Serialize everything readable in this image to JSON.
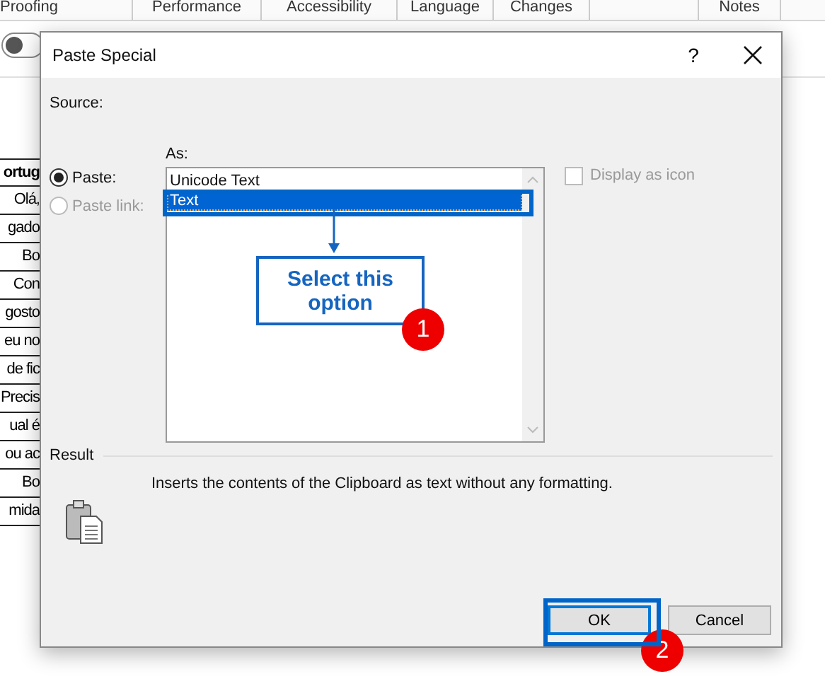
{
  "ribbon_groups": [
    {
      "label": "Proofing"
    },
    {
      "label": "Performance"
    },
    {
      "label": "Accessibility"
    },
    {
      "label": "Language"
    },
    {
      "label": "Changes"
    },
    {
      "label": "Notes"
    }
  ],
  "toggle": {
    "on": false
  },
  "table": {
    "rows": [
      {
        "text": "ortug",
        "header": true
      },
      {
        "text": "Olá,",
        "header": false
      },
      {
        "text": "gado",
        "header": false
      },
      {
        "text": "Bo",
        "header": false
      },
      {
        "text": "Con",
        "header": false
      },
      {
        "text": "gosto",
        "header": false
      },
      {
        "text": "eu no",
        "header": false
      },
      {
        "text": "de fic",
        "header": false
      },
      {
        "text": "Precis",
        "header": false
      },
      {
        "text": "ual é",
        "header": false
      },
      {
        "text": "ou ac",
        "header": false
      },
      {
        "text": "Bo",
        "header": false
      },
      {
        "text": "mida",
        "header": false
      }
    ]
  },
  "dialog": {
    "title": "Paste Special",
    "help": "?",
    "source_label": "Source:",
    "paste_options": [
      {
        "label": "Paste:",
        "selected": true,
        "disabled": false
      },
      {
        "label": "Paste link:",
        "selected": false,
        "disabled": true
      }
    ],
    "as_label": "As:",
    "formats": [
      {
        "label": "Unicode Text",
        "selected": false
      },
      {
        "label": "Text",
        "selected": true
      }
    ],
    "display_as_icon": {
      "label": "Display as icon",
      "checked": false,
      "disabled": true
    },
    "result_label": "Result",
    "result_text": "Inserts the contents of the Clipboard as text without any formatting.",
    "buttons": [
      {
        "label": "OK",
        "default": true
      },
      {
        "label": "Cancel",
        "default": false
      }
    ]
  },
  "annotations": {
    "callout": "Select this option",
    "badges": [
      "1",
      "2"
    ]
  }
}
